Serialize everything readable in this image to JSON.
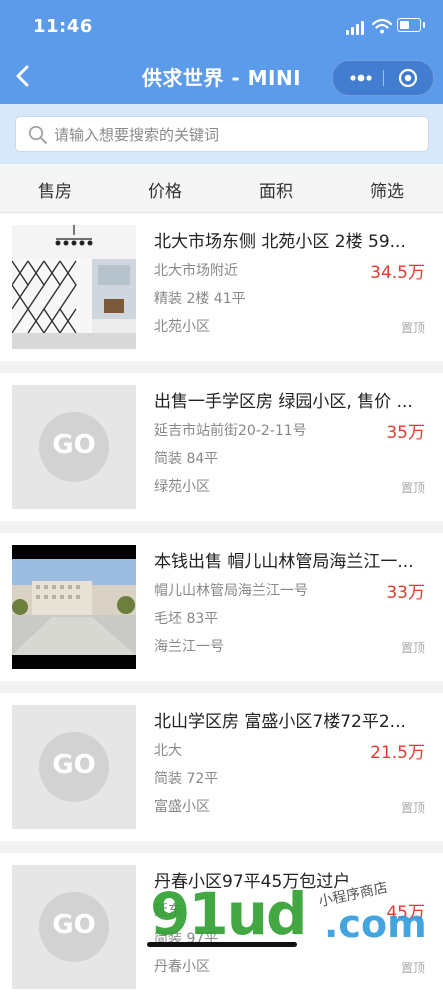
{
  "status": {
    "time": "11:46"
  },
  "nav": {
    "title": "供求世界 - MINI"
  },
  "search": {
    "placeholder": "请输入想要搜索的关键词"
  },
  "filters": [
    "售房",
    "价格",
    "面积",
    "筛选"
  ],
  "listings": [
    {
      "title": "北大市场东侧 北苑小区 2楼 59...",
      "address": "北大市场附近",
      "price": "34.5万",
      "spec": "精装 2楼 41平",
      "community": "北苑小区",
      "tag": "置顶",
      "image": "photo-room"
    },
    {
      "title": "出售一手学区房 绿园小区, 售价 ...",
      "address": "延吉市站前街20-2-11号",
      "price": "35万",
      "spec": "简装 84平",
      "community": "绿苑小区",
      "tag": "置顶",
      "image": "placeholder-logo"
    },
    {
      "title": "本钱出售 帽儿山林管局海兰江一...",
      "address": "帽儿山林管局海兰江一号",
      "price": "33万",
      "spec": "毛坯 83平",
      "community": "海兰江一号",
      "tag": "置顶",
      "image": "photo-building"
    },
    {
      "title": "北山学区房 富盛小区7楼72平2...",
      "address": "北大",
      "price": "21.5万",
      "spec": "简装 72平",
      "community": "富盛小区",
      "tag": "置顶",
      "image": "placeholder-logo"
    },
    {
      "title": "丹春小区97平45万包过户",
      "address": "延东",
      "price": "45万",
      "spec": "简装 97平",
      "community": "丹春小区",
      "tag": "置顶",
      "image": "placeholder-logo"
    }
  ],
  "placeholder_logo_text": "GO",
  "watermark": {
    "big": "91ud",
    "com": ".com",
    "hand": "小程序商店"
  },
  "colors": {
    "header": "#5b9bea",
    "price": "#e23a30",
    "search_bg": "#d8e8fb"
  }
}
